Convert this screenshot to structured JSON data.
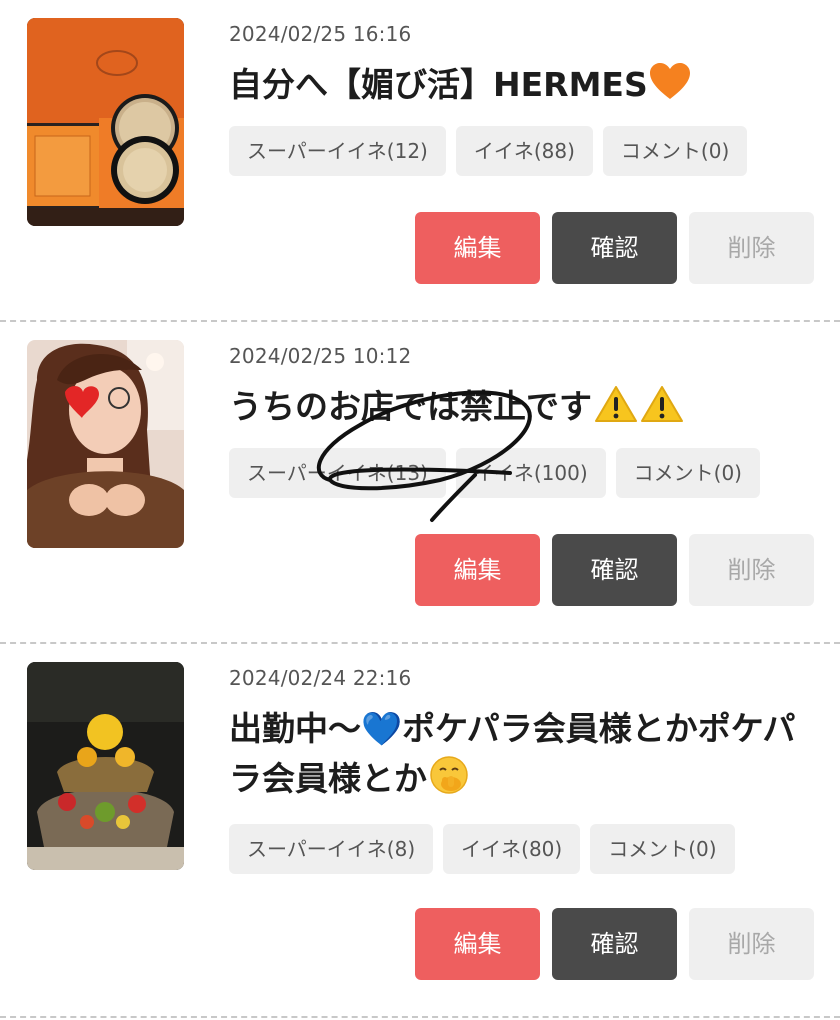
{
  "posts": [
    {
      "date": "2024/02/25 16:16",
      "title": "自分へ【媚び活】HERMES",
      "title_emoji": "orange-heart-icon",
      "tags": {
        "super_like": "スーパーイイネ(12)",
        "like": "イイネ(88)",
        "comment": "コメント(0)"
      },
      "actions": {
        "edit": "編集",
        "check": "確認",
        "delete": "削除"
      }
    },
    {
      "date": "2024/02/25 10:12",
      "title": "うちのお店では禁止です",
      "title_emoji": "warning-icon",
      "tags": {
        "super_like": "スーパーイイネ(13)",
        "like": "イイネ(100)",
        "comment": "コメント(0)"
      },
      "actions": {
        "edit": "編集",
        "check": "確認",
        "delete": "削除"
      }
    },
    {
      "date": "2024/02/24 22:16",
      "title": "出勤中〜💙ポケパラ会員様とかポケパラ会員様とか",
      "title_emoji": "face-with-hand-over-mouth-icon",
      "tags": {
        "super_like": "スーパーイイネ(8)",
        "like": "イイネ(80)",
        "comment": "コメント(0)"
      },
      "actions": {
        "edit": "編集",
        "check": "確認",
        "delete": "削除"
      }
    }
  ],
  "colors": {
    "edit": "#ee5f5f",
    "check": "#4a4a4a",
    "delete": "#efefef",
    "tag": "#efefef"
  }
}
